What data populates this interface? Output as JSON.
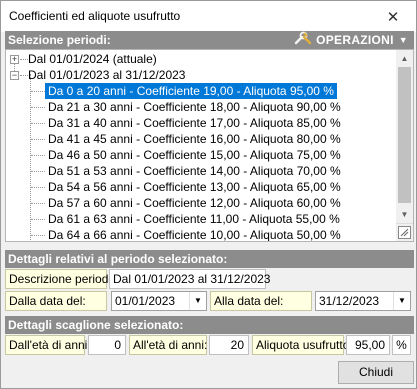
{
  "window": {
    "title": "Coefficienti ed aliquote usufrutto"
  },
  "periods_panel": {
    "header": "Selezione periodi:",
    "operations_label": "OPERAZIONI",
    "tree": {
      "nodes": [
        {
          "label": "Dal 01/01/2024 (attuale)",
          "expanded": false
        },
        {
          "label": "Dal 01/01/2023 al 31/12/2023",
          "expanded": true
        }
      ],
      "children": [
        "Da 0 a 20 anni - Coefficiente 19,00 - Aliquota 95,00 %",
        "Da 21 a 30 anni - Coefficiente 18,00 - Aliquota 90,00 %",
        "Da 31 a 40 anni - Coefficiente 17,00 - Aliquota 85,00 %",
        "Da 41 a 45 anni - Coefficiente 16,00 - Aliquota 80,00 %",
        "Da 46 a 50 anni - Coefficiente 15,00 - Aliquota 75,00 %",
        "Da 51 a 53 anni - Coefficiente 14,00 - Aliquota 70,00 %",
        "Da 54 a 56 anni - Coefficiente 13,00 - Aliquota 65,00 %",
        "Da 57 a 60 anni - Coefficiente 12,00 - Aliquota 60,00 %",
        "Da 61 a 63 anni - Coefficiente 11,00 - Aliquota 55,00 %",
        "Da 64 a 66 anni - Coefficiente 10,00 - Aliquota 50,00 %"
      ],
      "selected_index": 0
    }
  },
  "period_details": {
    "header": "Dettagli relativi al periodo selezionato:",
    "description_label": "Descrizione periodo:",
    "description_value": "Dal 01/01/2023 al 31/12/2023",
    "from_label": "Dalla data del:",
    "from_value": "01/01/2023",
    "to_label": "Alla data del:",
    "to_value": "31/12/2023"
  },
  "bracket_details": {
    "header": "Dettagli scaglione selezionato:",
    "age_from_label": "Dall'età di anni:",
    "age_from_value": "0",
    "age_to_label": "All'età di anni:",
    "age_to_value": "20",
    "rate_label": "Aliquota usufrutto:",
    "rate_value": "95,00",
    "rate_unit": "%"
  },
  "footer": {
    "close_label": "Chiudi"
  }
}
